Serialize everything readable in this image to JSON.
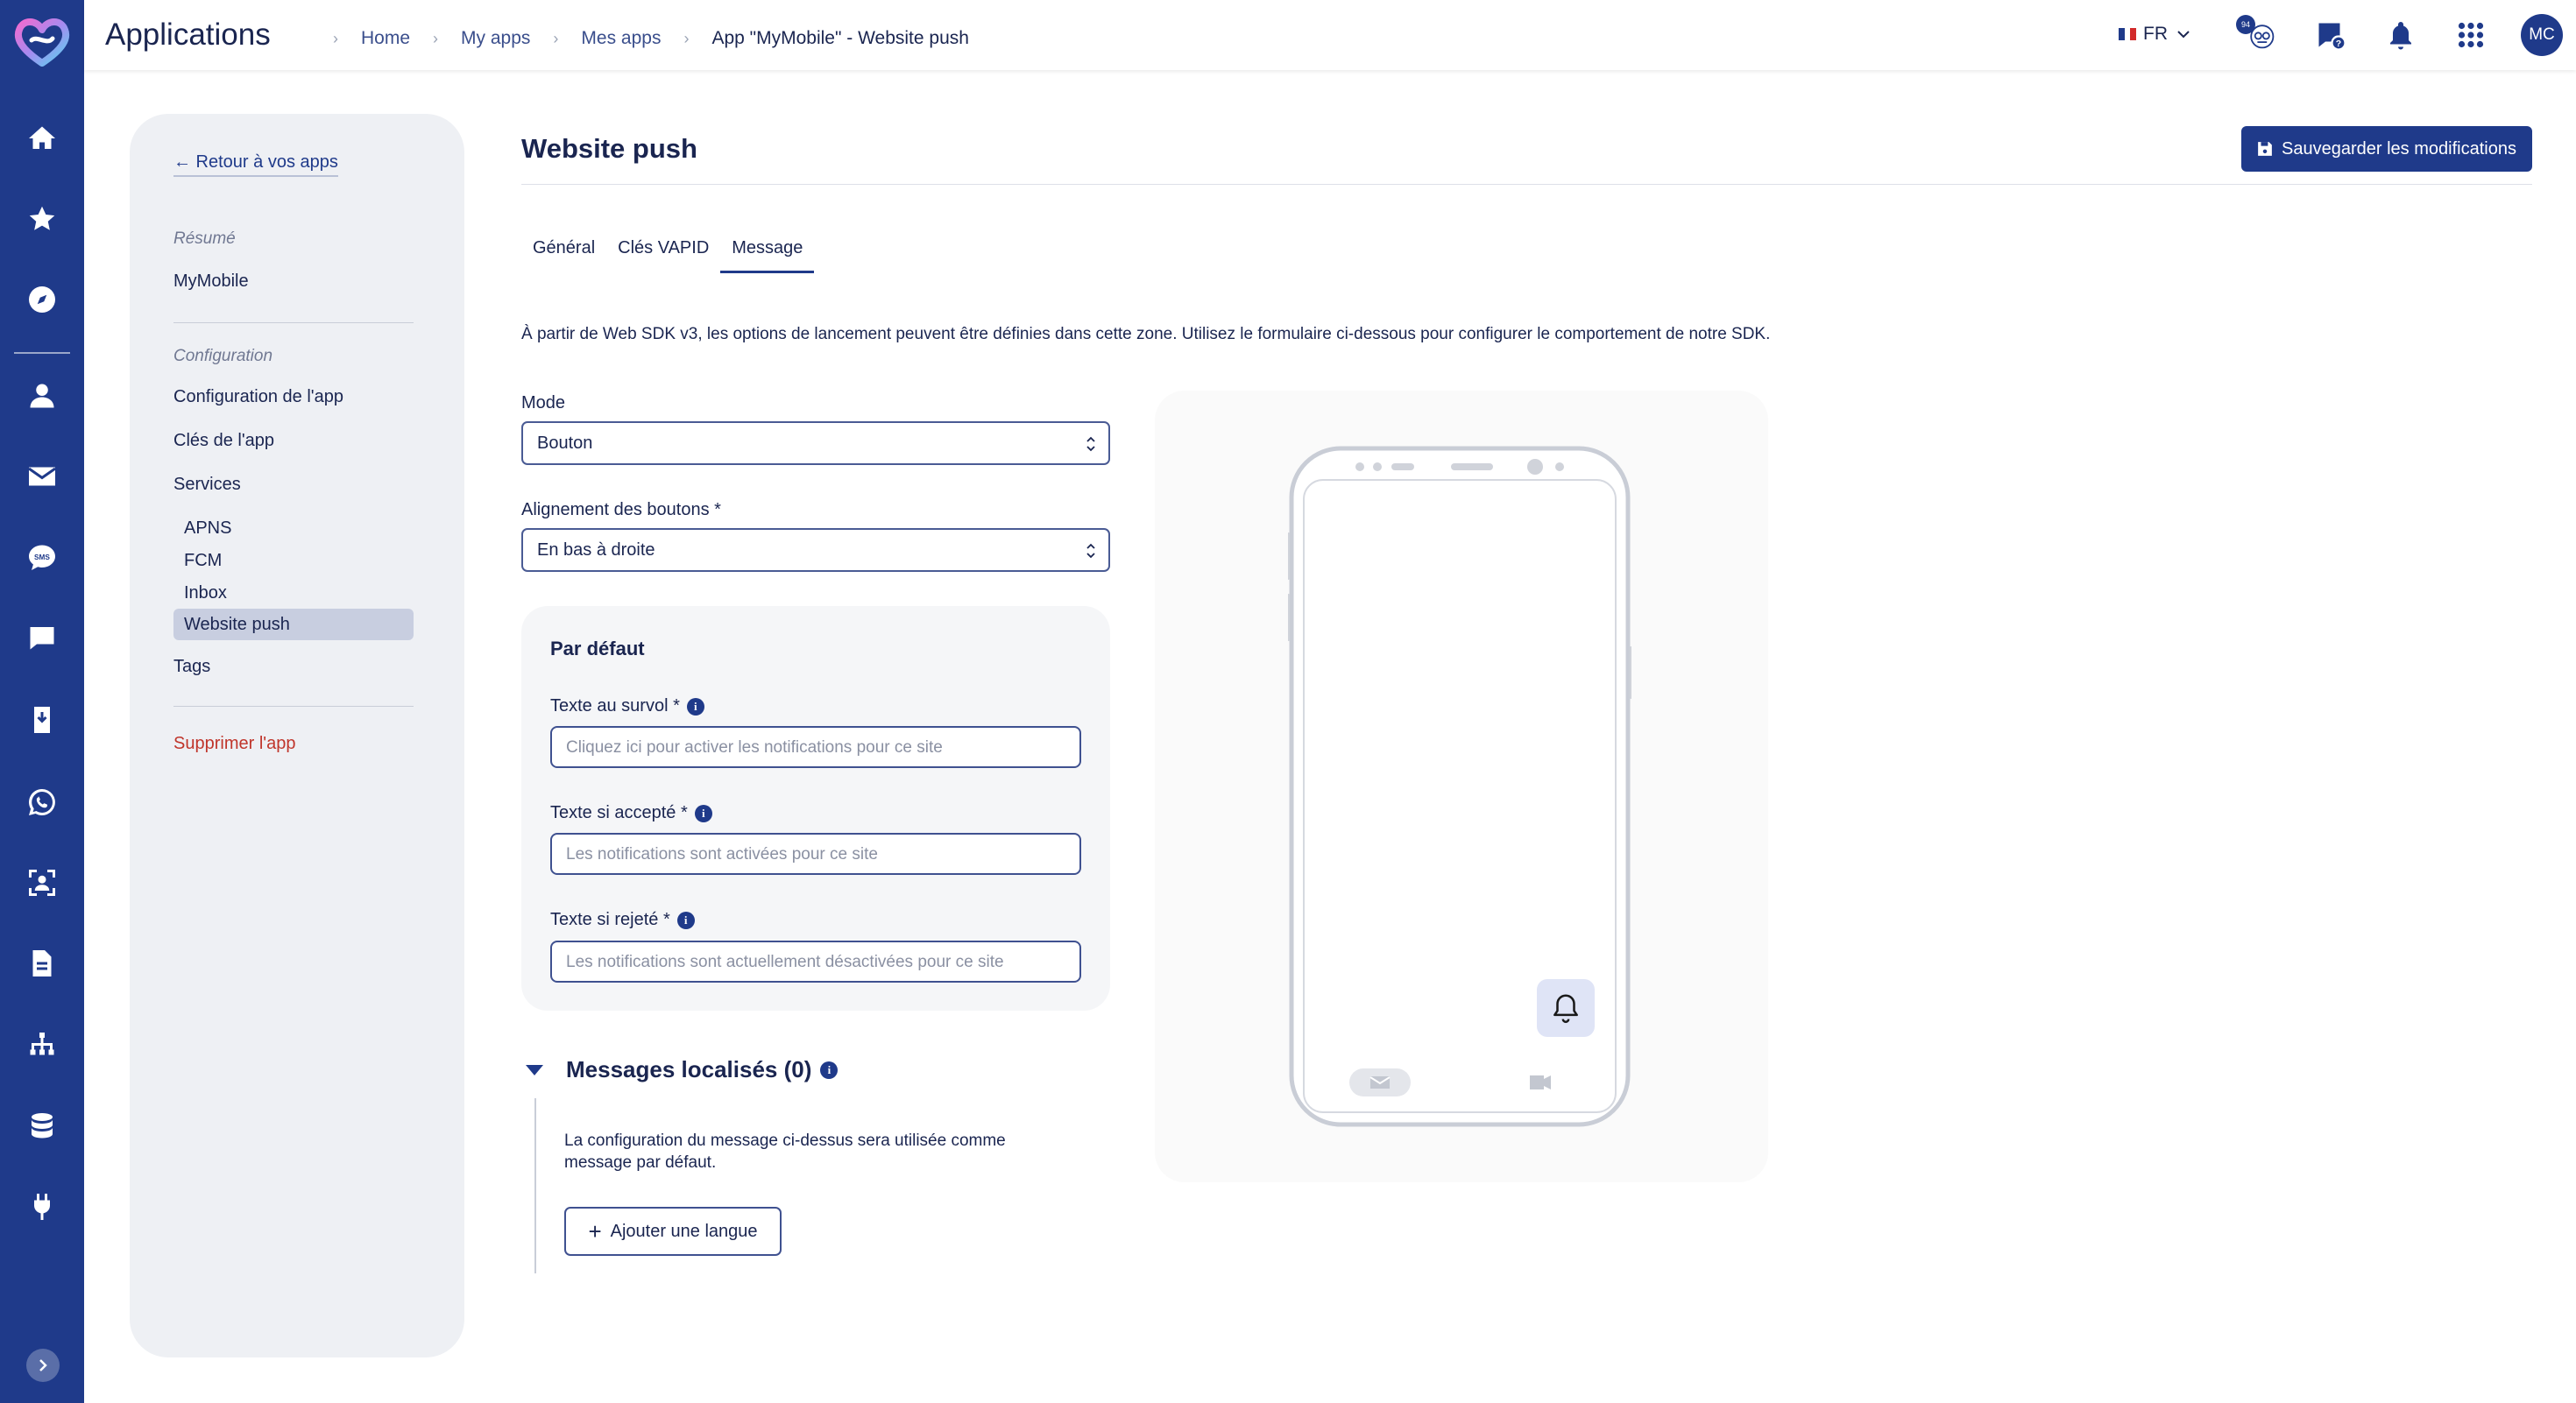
{
  "header": {
    "app_title": "Applications",
    "breadcrumbs": [
      "Home",
      "My apps",
      "Mes apps",
      "App \"MyMobile\" - Website push"
    ],
    "language": "FR",
    "avatar_initials": "MC",
    "notification_badge": "94"
  },
  "sidebar_nav": {
    "icons": [
      "home-icon",
      "star-icon",
      "compass-icon",
      "user-icon",
      "mail-icon",
      "sms-icon",
      "chat-icon",
      "mobile-push-icon",
      "whatsapp-icon",
      "face-scan-icon",
      "document-icon",
      "hierarchy-icon",
      "database-icon",
      "plug-icon"
    ]
  },
  "left_panel": {
    "back_link": "← Retour à vos apps",
    "summary_label": "Résumé",
    "app_name": "MyMobile",
    "config_label": "Configuration",
    "items": {
      "app_config": "Configuration de l'app",
      "app_keys": "Clés de l'app",
      "services": "Services",
      "apns": "APNS",
      "fcm": "FCM",
      "inbox": "Inbox",
      "website_push": "Website push",
      "tags": "Tags"
    },
    "delete_app": "Supprimer l'app"
  },
  "main": {
    "title": "Website push",
    "save_button": "Sauvegarder les modifications",
    "tabs": [
      "Général",
      "Clés VAPID",
      "Message"
    ],
    "active_tab": "Message",
    "intro": "À partir de Web SDK v3, les options de lancement peuvent être définies dans cette zone. Utilisez le formulaire ci-dessous pour configurer le comportement de notre SDK.",
    "mode_label": "Mode",
    "mode_value": "Bouton",
    "alignment_label": "Alignement des boutons *",
    "alignment_value": "En bas à droite",
    "default_card": {
      "title": "Par défaut",
      "hover_label": "Texte au survol *",
      "hover_placeholder": "Cliquez ici pour activer les notifications pour ce site",
      "accepted_label": "Texte si accepté *",
      "accepted_placeholder": "Les notifications sont activées pour ce site",
      "rejected_label": "Texte si rejeté *",
      "rejected_placeholder": "Les notifications sont actuellement désactivées pour ce site"
    },
    "localized": {
      "title": "Messages localisés (0)",
      "description": "La configuration du message ci-dessus sera utilisée comme message par défaut.",
      "add_button": "Ajouter une langue"
    }
  },
  "colors": {
    "primary": "#1f3a8a",
    "danger": "#c0352b",
    "panel_bg": "#eef0f4"
  }
}
